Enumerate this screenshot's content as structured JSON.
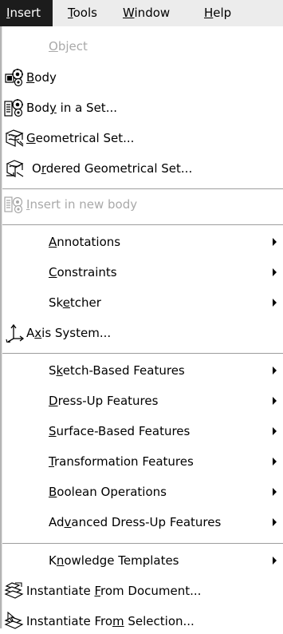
{
  "menubar": {
    "items": [
      {
        "id": "insert",
        "pre": "",
        "ul": "I",
        "post": "nsert",
        "active": true
      },
      {
        "id": "tools",
        "pre": "",
        "ul": "T",
        "post": "ools",
        "active": false
      },
      {
        "id": "window",
        "pre": "",
        "ul": "W",
        "post": "indow",
        "active": false
      },
      {
        "id": "help",
        "pre": "",
        "ul": "H",
        "post": "elp",
        "active": false
      }
    ]
  },
  "menu": {
    "items": [
      {
        "pre": "",
        "ul": "O",
        "post": "bject",
        "disabled": true,
        "icon": ""
      },
      {
        "pre": "",
        "ul": "B",
        "post": "ody",
        "disabled": false,
        "icon": "body-icon"
      },
      {
        "pre": "Bod",
        "ul": "y",
        "post": " in a Set...",
        "disabled": false,
        "icon": "body-in-set-icon"
      },
      {
        "pre": "",
        "ul": "G",
        "post": "eometrical Set...",
        "disabled": false,
        "icon": "geometrical-set-icon"
      },
      {
        "pre": "O",
        "ul": "r",
        "post": "dered Geometrical Set...",
        "disabled": false,
        "icon": "ordered-geometrical-set-icon"
      },
      {
        "pre": "",
        "ul": "I",
        "post": "nsert in new body",
        "disabled": true,
        "icon": "insert-new-body-icon"
      },
      {
        "pre": "",
        "ul": "A",
        "post": "nnotations",
        "disabled": false,
        "icon": "",
        "submenu": true
      },
      {
        "pre": "",
        "ul": "C",
        "post": "onstraints",
        "disabled": false,
        "icon": "",
        "submenu": true
      },
      {
        "pre": "Sk",
        "ul": "e",
        "post": "tcher",
        "disabled": false,
        "icon": "",
        "submenu": true
      },
      {
        "pre": "A",
        "ul": "x",
        "post": "is System...",
        "disabled": false,
        "icon": "axis-system-icon"
      },
      {
        "pre": "S",
        "ul": "k",
        "post": "etch-Based Features",
        "disabled": false,
        "icon": "",
        "submenu": true
      },
      {
        "pre": "",
        "ul": "D",
        "post": "ress-Up Features",
        "disabled": false,
        "icon": "",
        "submenu": true
      },
      {
        "pre": "",
        "ul": "S",
        "post": "urface-Based Features",
        "disabled": false,
        "icon": "",
        "submenu": true
      },
      {
        "pre": "",
        "ul": "T",
        "post": "ransformation Features",
        "disabled": false,
        "icon": "",
        "submenu": true
      },
      {
        "pre": "",
        "ul": "B",
        "post": "oolean Operations",
        "disabled": false,
        "icon": "",
        "submenu": true
      },
      {
        "pre": "Ad",
        "ul": "v",
        "post": "anced Dress-Up Features",
        "disabled": false,
        "icon": "",
        "submenu": true
      },
      {
        "pre": "K",
        "ul": "n",
        "post": "owledge Templates",
        "disabled": false,
        "icon": "",
        "submenu": true
      },
      {
        "pre": "Instantiate ",
        "ul": "F",
        "post": "rom Document...",
        "disabled": false,
        "icon": "instantiate-from-document-icon"
      },
      {
        "pre": "Instantiate Fro",
        "ul": "m",
        "post": " Selection...",
        "disabled": false,
        "icon": "instantiate-from-selection-icon"
      }
    ]
  }
}
